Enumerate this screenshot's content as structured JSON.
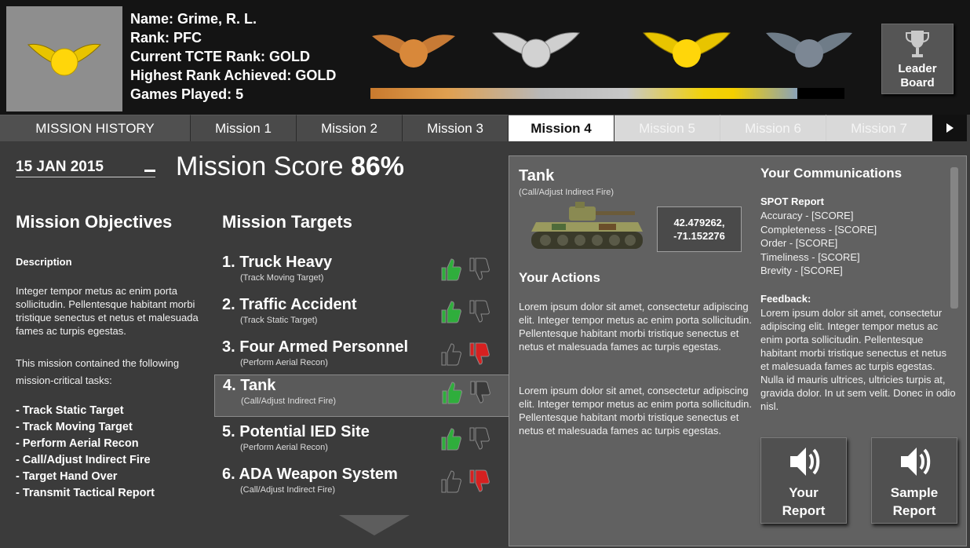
{
  "header": {
    "name_line": "Name: Grime, R. L.",
    "rank_line": "Rank: PFC",
    "tcte_line": "Current TCTE Rank: GOLD",
    "highest_line": "Highest Rank Achieved: GOLD",
    "games_line": "Games Played: 5",
    "current_badge_icon": "gold-winged-medal-icon",
    "rank_progress_percent": 90,
    "medals": [
      "bronze-winged-medal-icon",
      "silver-winged-medal-icon",
      "gold-winged-medal-icon",
      "platinum-winged-medal-icon"
    ],
    "leaderboard_label_1": "Leader",
    "leaderboard_label_2": "Board",
    "leaderboard_icon": "trophy-icon"
  },
  "tabs": {
    "history": "MISSION HISTORY",
    "items": [
      "Mission 1",
      "Mission 2",
      "Mission 3",
      "Mission 4",
      "Mission 5",
      "Mission 6",
      "Mission 7"
    ],
    "active_index": 3,
    "next_icon": "play-right-icon"
  },
  "main": {
    "date": "15 JAN 2015",
    "score_label": "Mission Score",
    "score_value": "86%",
    "objectives_head": "Mission Objectives",
    "targets_head": "Mission Targets",
    "description_head": "Description",
    "description": "Integer tempor metus ac enim porta sollicitudin. Pellentesque habitant morbi tristique senectus et netus et malesuada fames ac turpis egestas.",
    "description2": "This mission contained the following mission-critical tasks:",
    "tasks": [
      "- Track Static Target",
      "- Track Moving Target",
      "- Perform Aerial Recon",
      "- Call/Adjust Indirect Fire",
      "- Target Hand Over",
      "- Transmit Tactical Report"
    ],
    "targets": [
      {
        "name": "1. Truck Heavy",
        "sub": "(Track Moving Target)",
        "rating": "up"
      },
      {
        "name": "2. Traffic Accident",
        "sub": "(Track Static Target)",
        "rating": "up"
      },
      {
        "name": "3. Four Armed Personnel",
        "sub": "(Perform Aerial Recon)",
        "rating": "down"
      },
      {
        "name": "4. Tank",
        "sub": "(Call/Adjust Indirect Fire)",
        "rating": "up"
      },
      {
        "name": "5. Potential IED Site",
        "sub": "(Perform Aerial Recon)",
        "rating": "up"
      },
      {
        "name": "6. ADA Weapon System",
        "sub": "(Call/Adjust Indirect Fire)",
        "rating": "down"
      }
    ]
  },
  "detail": {
    "title": "Tank",
    "subtitle": "(Call/Adjust Indirect Fire)",
    "coord_lat": "42.479262,",
    "coord_lon": "-71.152276",
    "actions_head": "Your Actions",
    "lorem1": "Lorem ipsum dolor sit amet, consectetur adipiscing elit. Integer tempor metus ac enim porta sollicitudin. Pellentesque habitant morbi tristique senectus et netus et malesuada fames ac turpis egestas.",
    "lorem2": "Lorem ipsum dolor sit amet, consectetur adipiscing elit. Integer tempor metus ac enim porta sollicitudin. Pellentesque habitant morbi tristique senectus et netus et malesuada fames ac turpis egestas.",
    "comm_head": "Your Communications",
    "spot_head": "SPOT Report",
    "spot_items": [
      "Accuracy - [SCORE]",
      "Completeness - [SCORE]",
      "Order - [SCORE]",
      "Timeliness - [SCORE]",
      "Brevity - [SCORE]"
    ],
    "feedback_head": "Feedback:",
    "feedback": "Lorem ipsum dolor sit amet, consectetur adipiscing elit. Integer tempor metus ac enim porta sollicitudin. Pellentesque habitant morbi tristique senectus et netus et malesuada fames ac turpis egestas. Nulla id mauris ultrices, ultricies turpis at, gravida dolor. In ut sem velit. Donec in odio nisl.",
    "your_report_1": "Your",
    "your_report_2": "Report",
    "sample_report_1": "Sample",
    "sample_report_2": "Report",
    "report_icon": "speaker-icon"
  },
  "colors": {
    "thumb_up": "#2fae3c",
    "thumb_down": "#d62020",
    "thumb_idle": "#3a3a3a",
    "gold": "#f4cf00",
    "silver": "#c0c0c0",
    "bronze": "#c77a35"
  }
}
